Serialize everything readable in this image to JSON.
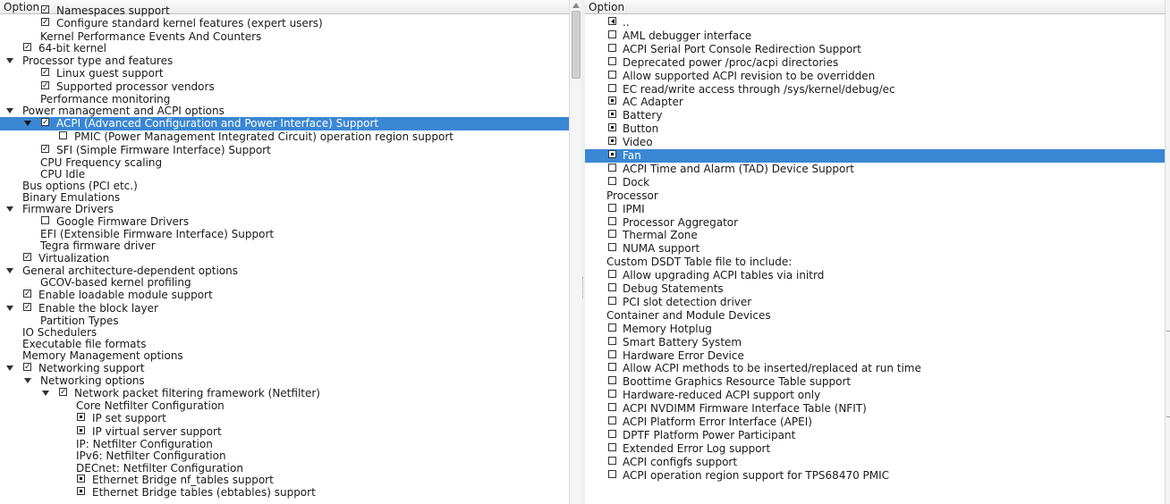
{
  "left": {
    "header": "Option",
    "rows": [
      {
        "label": "Namespaces support",
        "check": "checked",
        "ind": 1
      },
      {
        "label": "Configure standard kernel features (expert users)",
        "check": "checked",
        "ind": 1
      },
      {
        "label": "Kernel Performance Events And Counters",
        "check": "none",
        "ind": 1
      },
      {
        "label": "64-bit kernel",
        "check": "checked",
        "ind": 0
      },
      {
        "label": "Processor type and features",
        "check": "none",
        "ind": 0,
        "arrow": true
      },
      {
        "label": "Linux guest support",
        "check": "checked",
        "ind": 1
      },
      {
        "label": "Supported processor vendors",
        "check": "checked",
        "ind": 1
      },
      {
        "label": "Performance monitoring",
        "check": "none",
        "ind": 1
      },
      {
        "label": "Power management and ACPI options",
        "check": "none",
        "ind": 0,
        "arrow": true
      },
      {
        "label": "ACPI (Advanced Configuration and Power Interface) Support",
        "check": "checked",
        "ind": 1,
        "arrow": true,
        "selected": true
      },
      {
        "label": "PMIC (Power Management Integrated Circuit) operation region support",
        "check": "empty",
        "ind": 2
      },
      {
        "label": "SFI (Simple Firmware Interface) Support",
        "check": "checked",
        "ind": 1
      },
      {
        "label": "CPU Frequency scaling",
        "check": "none",
        "ind": 1
      },
      {
        "label": "CPU Idle",
        "check": "none",
        "ind": 1
      },
      {
        "label": "Bus options (PCI etc.)",
        "check": "none",
        "ind": 0
      },
      {
        "label": "Binary Emulations",
        "check": "none",
        "ind": 0
      },
      {
        "label": "Firmware Drivers",
        "check": "none",
        "ind": 0,
        "arrow": true
      },
      {
        "label": "Google Firmware Drivers",
        "check": "empty",
        "ind": 1
      },
      {
        "label": "EFI (Extensible Firmware Interface) Support",
        "check": "none",
        "ind": 1
      },
      {
        "label": "Tegra firmware driver",
        "check": "none",
        "ind": 1
      },
      {
        "label": "Virtualization",
        "check": "checked",
        "ind": 0
      },
      {
        "label": "General architecture-dependent options",
        "check": "none",
        "ind": 0,
        "arrow": true
      },
      {
        "label": "GCOV-based kernel profiling",
        "check": "none",
        "ind": 1
      },
      {
        "label": "Enable loadable module support",
        "check": "checked",
        "ind": 0
      },
      {
        "label": "Enable the block layer",
        "check": "checked",
        "ind": 0,
        "arrow": true
      },
      {
        "label": "Partition Types",
        "check": "none",
        "ind": 1
      },
      {
        "label": "IO Schedulers",
        "check": "none",
        "ind": 0
      },
      {
        "label": "Executable file formats",
        "check": "none",
        "ind": 0
      },
      {
        "label": "Memory Management options",
        "check": "none",
        "ind": 0
      },
      {
        "label": "Networking support",
        "check": "checked",
        "ind": 0,
        "arrow": true
      },
      {
        "label": "Networking options",
        "check": "none",
        "ind": 1,
        "arrow": true
      },
      {
        "label": "Network packet filtering framework (Netfilter)",
        "check": "checked",
        "ind": 2,
        "arrow": true
      },
      {
        "label": "Core Netfilter Configuration",
        "check": "none",
        "ind": 3
      },
      {
        "label": "IP set support",
        "check": "radio",
        "ind": 3
      },
      {
        "label": "IP virtual server support",
        "check": "radio",
        "ind": 3
      },
      {
        "label": "IP: Netfilter Configuration",
        "check": "none",
        "ind": 3
      },
      {
        "label": "IPv6: Netfilter Configuration",
        "check": "none",
        "ind": 3
      },
      {
        "label": "DECnet: Netfilter Configuration",
        "check": "none",
        "ind": 3
      },
      {
        "label": "Ethernet Bridge nf_tables support",
        "check": "radio",
        "ind": 3
      },
      {
        "label": "Ethernet Bridge tables (ebtables) support",
        "check": "radio",
        "ind": 3
      }
    ]
  },
  "right": {
    "header": "Option",
    "rows": [
      {
        "label": "..",
        "check": "back"
      },
      {
        "label": "AML debugger interface",
        "check": "empty"
      },
      {
        "label": "ACPI Serial Port Console Redirection Support",
        "check": "empty"
      },
      {
        "label": "Deprecated power /proc/acpi directories",
        "check": "empty"
      },
      {
        "label": "Allow supported ACPI revision to be overridden",
        "check": "empty"
      },
      {
        "label": "EC read/write access through /sys/kernel/debug/ec",
        "check": "empty"
      },
      {
        "label": "AC Adapter",
        "check": "radio"
      },
      {
        "label": "Battery",
        "check": "radio"
      },
      {
        "label": "Button",
        "check": "radio"
      },
      {
        "label": "Video",
        "check": "radio"
      },
      {
        "label": "Fan",
        "check": "radio",
        "selected": true
      },
      {
        "label": "ACPI Time and Alarm (TAD) Device Support",
        "check": "empty"
      },
      {
        "label": "Dock",
        "check": "empty"
      },
      {
        "label": "Processor",
        "check": "none"
      },
      {
        "label": "IPMI",
        "check": "empty"
      },
      {
        "label": "Processor Aggregator",
        "check": "empty"
      },
      {
        "label": "Thermal Zone",
        "check": "empty"
      },
      {
        "label": "NUMA support",
        "check": "empty"
      },
      {
        "label": "Custom DSDT Table file to include:",
        "check": "none"
      },
      {
        "label": "Allow upgrading ACPI tables via initrd",
        "check": "empty"
      },
      {
        "label": "Debug Statements",
        "check": "empty"
      },
      {
        "label": "PCI slot detection driver",
        "check": "empty"
      },
      {
        "label": "Container and Module Devices",
        "check": "none"
      },
      {
        "label": "Memory Hotplug",
        "check": "empty"
      },
      {
        "label": "Smart Battery System",
        "check": "empty"
      },
      {
        "label": "Hardware Error Device",
        "check": "empty"
      },
      {
        "label": "Allow ACPI methods to be inserted/replaced at run time",
        "check": "empty"
      },
      {
        "label": "Boottime Graphics Resource Table support",
        "check": "empty"
      },
      {
        "label": "Hardware-reduced ACPI support only",
        "check": "empty"
      },
      {
        "label": "ACPI NVDIMM Firmware Interface Table (NFIT)",
        "check": "empty"
      },
      {
        "label": "ACPI Platform Error Interface (APEI)",
        "check": "empty"
      },
      {
        "label": "DPTF Platform Power Participant",
        "check": "empty"
      },
      {
        "label": "Extended Error Log support",
        "check": "empty"
      },
      {
        "label": "ACPI configfs support",
        "check": "empty"
      },
      {
        "label": "ACPI operation region support for TPS68470 PMIC",
        "check": "empty"
      }
    ]
  },
  "colors": {
    "selection": "#3a87d4",
    "selection_text": "#ffffff"
  }
}
